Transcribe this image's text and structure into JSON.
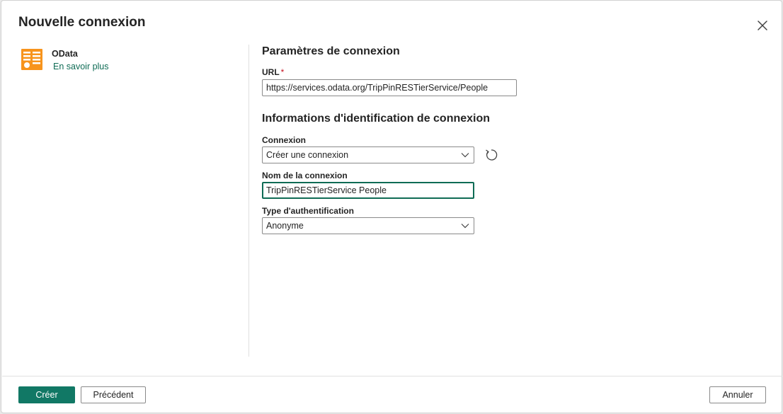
{
  "dialog": {
    "title": "Nouvelle connexion",
    "close_icon": "close-icon"
  },
  "connector": {
    "name": "OData",
    "learn_more": "En savoir plus",
    "icon": "odata-connector-icon",
    "icon_color": "#f7941d"
  },
  "connection_settings": {
    "title": "Paramètres de connexion",
    "url_label": "URL",
    "required_marker": "*",
    "url_value": "https://services.odata.org/TripPinRESTierService/People"
  },
  "credentials": {
    "title": "Informations d'identification de connexion",
    "connection_label": "Connexion",
    "connection_value": "Créer une connexion",
    "connection_name_label": "Nom de la connexion",
    "connection_name_value": "TripPinRESTierService People",
    "auth_type_label": "Type d'authentification",
    "auth_type_value": "Anonyme",
    "refresh_icon": "refresh-icon"
  },
  "footer": {
    "create_label": "Créer",
    "previous_label": "Précédent",
    "cancel_label": "Annuler"
  },
  "colors": {
    "accent": "#117865",
    "link": "#0f6c55",
    "required": "#c50f1f"
  }
}
